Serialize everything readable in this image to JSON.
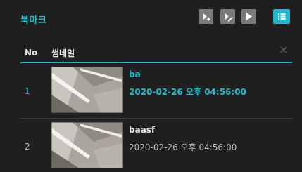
{
  "header": {
    "title": "북마크",
    "buttons": [
      {
        "name": "add-bookmark-button",
        "icon": "bookmark-add-icon"
      },
      {
        "name": "edit-bookmark-button",
        "icon": "bookmark-edit-icon"
      },
      {
        "name": "play-bookmark-button",
        "icon": "play-icon"
      },
      {
        "name": "list-view-button",
        "icon": "list-icon",
        "active": true
      }
    ]
  },
  "table": {
    "columns": {
      "no": "No",
      "thumbnail": "썸네일"
    },
    "rows": [
      {
        "no": "1",
        "name": "ba",
        "date": "2020-02-26 오후 04:56:00",
        "selected": true
      },
      {
        "no": "2",
        "name": "baasf",
        "date": "2020-02-26 오후 04:56:00",
        "selected": false
      }
    ]
  },
  "colors": {
    "accent": "#20b8c8",
    "background": "#1f1f1f",
    "button": "#7a7a7a",
    "divider": "#3a3a3a"
  }
}
